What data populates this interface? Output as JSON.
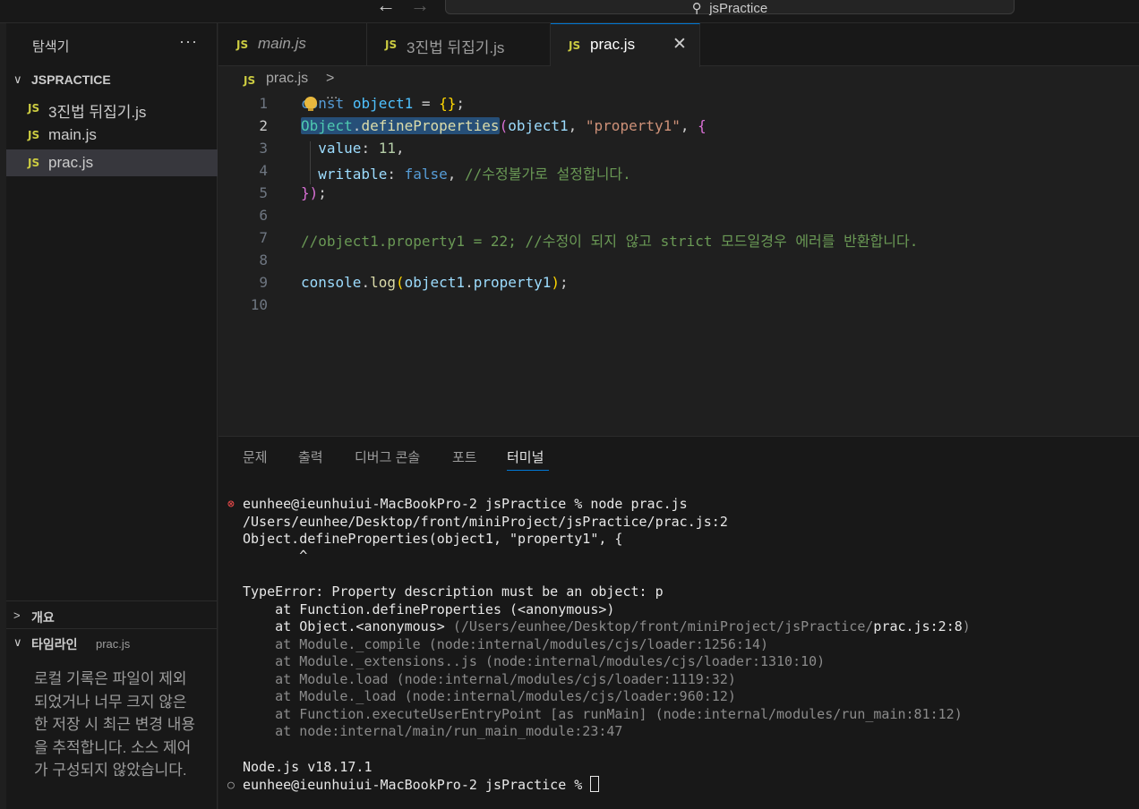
{
  "titlebar": {
    "back_icon": "←",
    "forward_icon": "→",
    "search_icon": "⚲",
    "search_text": "jsPractice"
  },
  "sidebar": {
    "title": "탐색기",
    "more_label": "···",
    "folder": {
      "chevron": "∨",
      "label": "JSPRACTICE"
    },
    "files": [
      {
        "badge": "JS",
        "label": "3진법 뒤집기.js",
        "active": false
      },
      {
        "badge": "JS",
        "label": "main.js",
        "active": false
      },
      {
        "badge": "JS",
        "label": "prac.js",
        "active": true
      }
    ],
    "outline": {
      "chevron": ">",
      "label": "개요"
    },
    "timeline": {
      "chevron": "∨",
      "label": "타임라인",
      "file": "prac.js",
      "message": "로컬 기록은 파일이 제외되었거나 너무 크지 않은 한 저장 시 최근 변경 내용을 추적합니다. 소스 제어가 구성되지 않았습니다."
    }
  },
  "tabs": [
    {
      "badge": "JS",
      "label": "main.js",
      "italic": true,
      "active": false
    },
    {
      "badge": "JS",
      "label": "3진법 뒤집기.js",
      "italic": false,
      "active": false
    },
    {
      "badge": "JS",
      "label": "prac.js",
      "italic": false,
      "active": true,
      "close": "✕"
    }
  ],
  "breadcrumb": {
    "badge": "JS",
    "file": "prac.js",
    "separator": "> ..."
  },
  "editor": {
    "line_numbers": [
      "1",
      "2",
      "3",
      "4",
      "5",
      "6",
      "7",
      "8",
      "9",
      "10"
    ],
    "current_line": 2,
    "lines": [
      {
        "t1": "const",
        "t2": " ",
        "t3": "object1",
        "t4": " = ",
        "t5": "{}",
        "t6": ";"
      },
      {
        "t1": "Object",
        "t2": ".",
        "t3": "defineProperties",
        "t4": "(",
        "t5": "object1",
        "t6": ", ",
        "t7": "\"property1\"",
        "t8": ", ",
        "t9": "{"
      },
      {
        "t1": "  value",
        "t2": ": ",
        "t3": "11",
        "t4": ","
      },
      {
        "t1": "  writable",
        "t2": ": ",
        "t3": "false",
        "t4": ", ",
        "t5": "//수정불가로 설정합니다."
      },
      {
        "t1": "}",
        "t2": ")",
        "t3": ";"
      },
      {},
      {
        "t1": "//object1.property1 = 22; //수정이 되지 않고 strict 모드일경우 에러를 반환합니다."
      },
      {},
      {
        "t1": "console",
        "t2": ".",
        "t3": "log",
        "t4": "(",
        "t5": "object1",
        "t6": ".",
        "t7": "property1",
        "t8": ")",
        "t9": ";"
      },
      {}
    ]
  },
  "panel": {
    "tabs": [
      "문제",
      "출력",
      "디버그 콘솔",
      "포트",
      "터미널"
    ],
    "active_tab": "터미널",
    "terminal": {
      "error_marker": "⊗",
      "prompt_marker": "○",
      "lines": [
        "eunhee@ieunhuiui-MacBookPro-2 jsPractice % node prac.js",
        "/Users/eunhee/Desktop/front/miniProject/jsPractice/prac.js:2",
        "Object.defineProperties(object1, \"property1\", {",
        "       ^",
        "",
        "TypeError: Property description must be an object: p",
        "    at Function.defineProperties (<anonymous>)",
        "    at Object.<anonymous> ",
        "    at Module._compile (node:internal/modules/cjs/loader:1256:14)",
        "    at Module._extensions..js (node:internal/modules/cjs/loader:1310:10)",
        "    at Module.load (node:internal/modules/cjs/loader:1119:32)",
        "    at Module._load (node:internal/modules/cjs/loader:960:12)",
        "    at Function.executeUserEntryPoint [as runMain] (node:internal/modules/run_main:81:12)",
        "    at node:internal/main/run_main_module:23:47",
        "",
        "Node.js v18.17.1",
        "eunhee@ieunhuiui-MacBookPro-2 jsPractice % "
      ],
      "stack_path_dim": "(/Users/eunhee/Desktop/front/miniProject/jsPractice/",
      "stack_path_bright": "prac.js:2:8",
      "stack_path_close": ")"
    }
  },
  "colors": {
    "accent": "#0078d4",
    "js_badge": "#cbcb41",
    "error": "#f14c4c"
  }
}
